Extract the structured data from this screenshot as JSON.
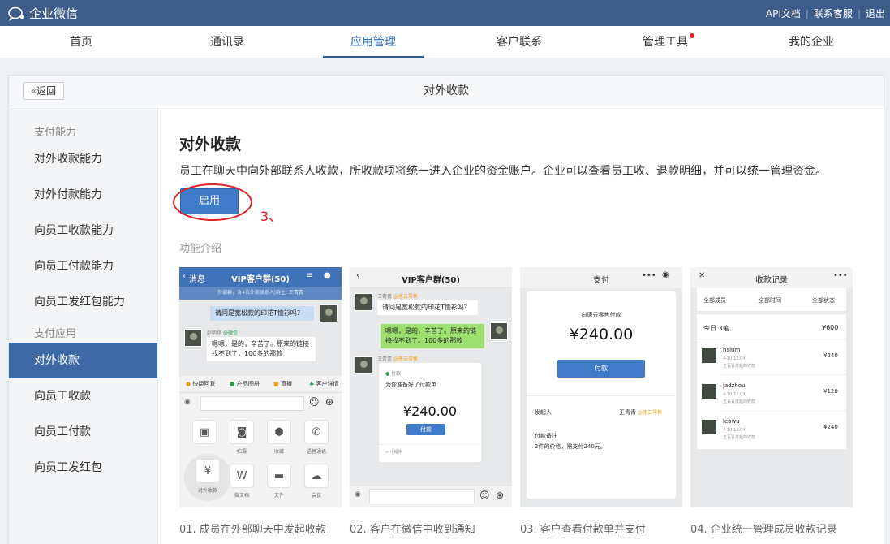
{
  "topbar": {
    "logo_text": "企业微信",
    "links": [
      "API文档",
      "联系客服",
      "退出"
    ],
    "bg_color": "#3c5d8a"
  },
  "nav": {
    "items": [
      "首页",
      "通讯录",
      "应用管理",
      "客户联系",
      "管理工具",
      "我的企业"
    ],
    "active": "应用管理"
  },
  "panel": {
    "back_label": "返回",
    "title": "对外收款"
  },
  "sidebar": {
    "sections": [
      {
        "title": "支付能力",
        "items": [
          "对外收款能力",
          "对外付款能力",
          "向员工收款能力",
          "向员工付款能力",
          "向员工发红包能力"
        ]
      },
      {
        "title": "支付应用",
        "items": [
          "对外收款",
          "向员工收款",
          "向员工付款",
          "向员工发红包"
        ]
      }
    ],
    "active": "对外收款",
    "active_color": "#3d6aa6"
  },
  "main": {
    "heading": "对外收款",
    "description": "员工在聊天中向外部联系人收款，所收款项将统一进入企业的资金账户。企业可以查看员工收、退款明细，并可以统一管理资金。",
    "enable_label": "启用",
    "annotation_number": "3、",
    "feature_title": "功能介绍",
    "captions": [
      "01. 成员在外部聊天中发起收款",
      "02. 客户在微信中收到通知",
      "03. 客户查看付款单并支付",
      "04. 企业统一管理成员收款记录"
    ]
  },
  "card1": {
    "back": "消息",
    "title": "VIP客户群(50)",
    "subtitle": "外部群，含4位外部联系人|群主: 王青青",
    "msg_out": "请问是宽松款的印花T恤衫吗?",
    "sender": "赵明登",
    "sender_tag": "@微信",
    "msg_in": "嗯嗯，是的，辛苦了。原来的链接找不到了，100多的那款",
    "tools": [
      "快捷回复",
      "产品图册",
      "直播",
      "客户详情"
    ],
    "grid_labels": [
      "拍摄",
      "收藏",
      "语音通话",
      "微文档",
      "文件",
      "会议",
      "对外收款"
    ]
  },
  "card2": {
    "title": "VIP客户群(50)",
    "sender": "王青青",
    "sender_tag": "@唐云零售",
    "msg_in": "请问是宽松款的印花T恤衫吗?",
    "msg_out": "嗯嗯，是的，辛苦了。原来的链接找不到了。100多的那款",
    "sender2": "王青青",
    "sender2_tag": "@唐云零售",
    "pay_header": "付款",
    "pay_desc": "为你准备好了付款单",
    "amount": "¥240.00",
    "pay_btn": "付款",
    "footer": "小程序"
  },
  "card3": {
    "title": "支付",
    "merchant": "向唐云零售付款",
    "amount": "¥240.00",
    "pay_btn": "付款",
    "initiator_label": "发起人",
    "initiator": "王青青",
    "initiator_tag": "@唐云零售",
    "note_label": "付款备注",
    "note": "2件的价格，需支付240元。"
  },
  "card4": {
    "title": "收款记录",
    "filters": [
      "全部成员",
      "全部时间",
      "全部状态"
    ],
    "summary_label": "今日 3笔",
    "summary_amount": "¥600",
    "records": [
      {
        "name": "hsium",
        "time": "4-10 12:04",
        "note": "王青青发起的收款",
        "amount": "¥240"
      },
      {
        "name": "jadzhou",
        "time": "4-10 12:03",
        "note": "王青青发起的收款",
        "amount": "¥120"
      },
      {
        "name": "leowu",
        "time": "4-10 12:04",
        "note": "王青青发起的收款",
        "amount": "¥240"
      }
    ]
  }
}
